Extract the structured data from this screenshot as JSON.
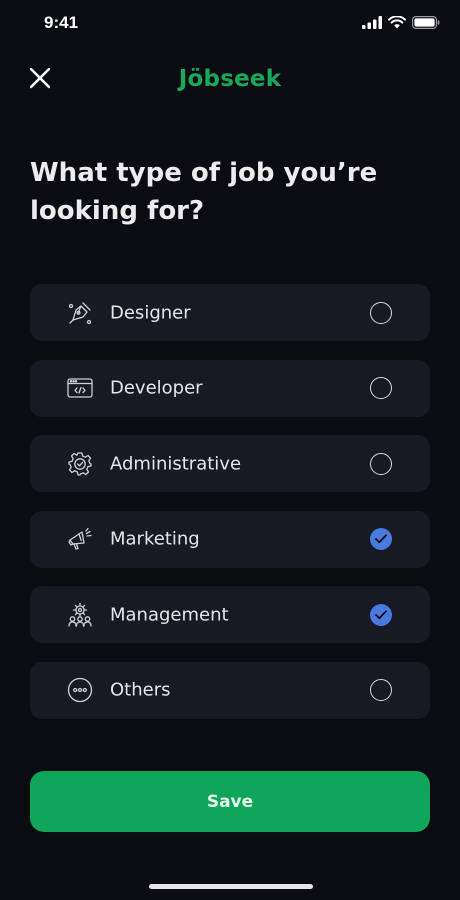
{
  "status": {
    "time": "9:41"
  },
  "header": {
    "brand": "Jöbseek",
    "close_icon": "close-icon"
  },
  "question": "What type of job you’re looking for?",
  "options": [
    {
      "label": "Designer",
      "icon": "pen-tool-icon",
      "selected": false
    },
    {
      "label": "Developer",
      "icon": "code-window-icon",
      "selected": false
    },
    {
      "label": "Administrative",
      "icon": "gear-check-icon",
      "selected": false
    },
    {
      "label": "Marketing",
      "icon": "megaphone-icon",
      "selected": true
    },
    {
      "label": "Management",
      "icon": "team-gear-icon",
      "selected": true
    },
    {
      "label": "Others",
      "icon": "more-icon",
      "selected": false
    }
  ],
  "save_label": "Save",
  "colors": {
    "brand": "#1aa85a",
    "accent_selected": "#4a7ae0",
    "save_button": "#0fa659",
    "background": "#0b0c12",
    "card": "#171923"
  }
}
